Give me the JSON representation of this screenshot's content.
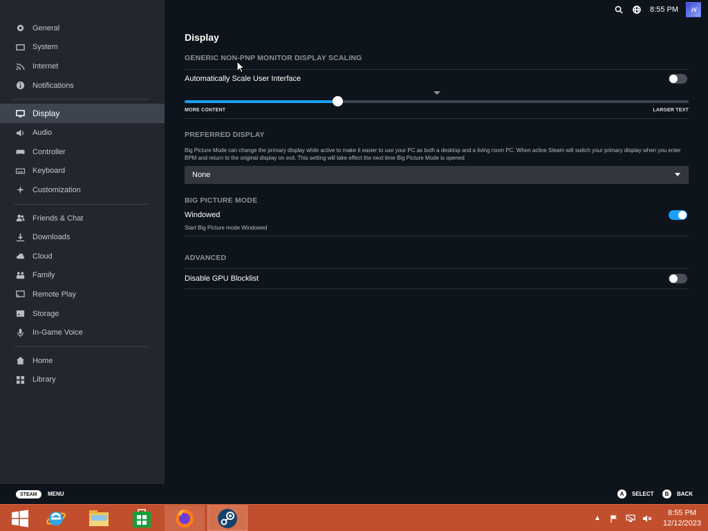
{
  "sidebar": {
    "groups": [
      [
        {
          "label": "General",
          "icon": "gear-icon"
        },
        {
          "label": "System",
          "icon": "system-icon"
        },
        {
          "label": "Internet",
          "icon": "wifi-icon"
        },
        {
          "label": "Notifications",
          "icon": "info-icon"
        }
      ],
      [
        {
          "label": "Display",
          "icon": "monitor-icon",
          "active": true
        },
        {
          "label": "Audio",
          "icon": "speaker-icon"
        },
        {
          "label": "Controller",
          "icon": "gamepad-icon"
        },
        {
          "label": "Keyboard",
          "icon": "keyboard-icon"
        },
        {
          "label": "Customization",
          "icon": "sparkle-icon"
        }
      ],
      [
        {
          "label": "Friends & Chat",
          "icon": "friends-icon"
        },
        {
          "label": "Downloads",
          "icon": "download-icon"
        },
        {
          "label": "Cloud",
          "icon": "cloud-icon"
        },
        {
          "label": "Family",
          "icon": "family-icon"
        },
        {
          "label": "Remote Play",
          "icon": "cast-icon"
        },
        {
          "label": "Storage",
          "icon": "storage-icon"
        },
        {
          "label": "In-Game Voice",
          "icon": "mic-icon"
        }
      ],
      [
        {
          "label": "Home",
          "icon": "home-icon"
        },
        {
          "label": "Library",
          "icon": "grid-icon"
        }
      ]
    ]
  },
  "topbar": {
    "time": "8:55 PM",
    "avatar_text": "ꟽ"
  },
  "main": {
    "title": "Display",
    "scaling": {
      "heading": "GENERIC NON-PNP MONITOR DISPLAY SCALING",
      "toggle_label": "Automatically Scale User Interface",
      "toggle_on": false,
      "slider_value": 0.303,
      "slider_left_label": "MORE CONTENT",
      "slider_right_label": "LARGER TEXT"
    },
    "preferred": {
      "heading": "PREFERRED DISPLAY",
      "description": "Big Picture Mode can change the primary display while active to make it easier to use your PC as both a desktop and a living room PC. When active Steam will switch your primary display when you enter BPM and return to the original display on exit. This setting will take effect the next time Big Picture Mode is opened",
      "selected": "None"
    },
    "bigpicture": {
      "heading": "BIG PICTURE MODE",
      "toggle_label": "Windowed",
      "toggle_on": true,
      "description": "Start Big Picture mode Windowed"
    },
    "advanced": {
      "heading": "ADVANCED",
      "toggle_label": "Disable GPU Blocklist",
      "toggle_on": false
    }
  },
  "footer": {
    "steam_label": "STEAM",
    "menu_label": "MENU",
    "a_glyph": "A",
    "select_label": "SELECT",
    "b_glyph": "B",
    "back_label": "BACK"
  },
  "taskbar": {
    "apps": [
      "windows-start-icon",
      "internet-explorer-icon",
      "file-explorer-icon",
      "store-icon",
      "firefox-icon",
      "steam-icon"
    ],
    "clock_time": "8:55 PM",
    "clock_date": "12/12/2023",
    "accent": "#c14f2d"
  }
}
